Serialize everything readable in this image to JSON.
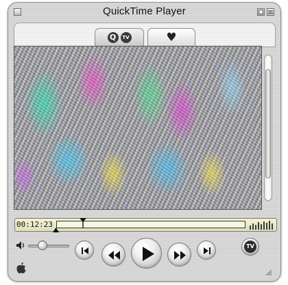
{
  "window": {
    "title": "QuickTime Player"
  },
  "tabs": [
    {
      "icons": [
        "quicktime-q-icon",
        "tv-icon"
      ],
      "label": "",
      "q_glyph": "Q",
      "tv_glyph": "TV"
    },
    {
      "icons": [
        "heart-icon"
      ],
      "label": "",
      "heart_glyph": "♥"
    }
  ],
  "video": {
    "content": "static-noise"
  },
  "transport": {
    "timecode": "00:12:23",
    "progress_fraction": 0.14,
    "volume_fraction": 0.35,
    "tv_button_label": "TV"
  },
  "colors": {
    "lcd_background": "#e9e9c8",
    "window_metal": "#d9d9d9"
  }
}
